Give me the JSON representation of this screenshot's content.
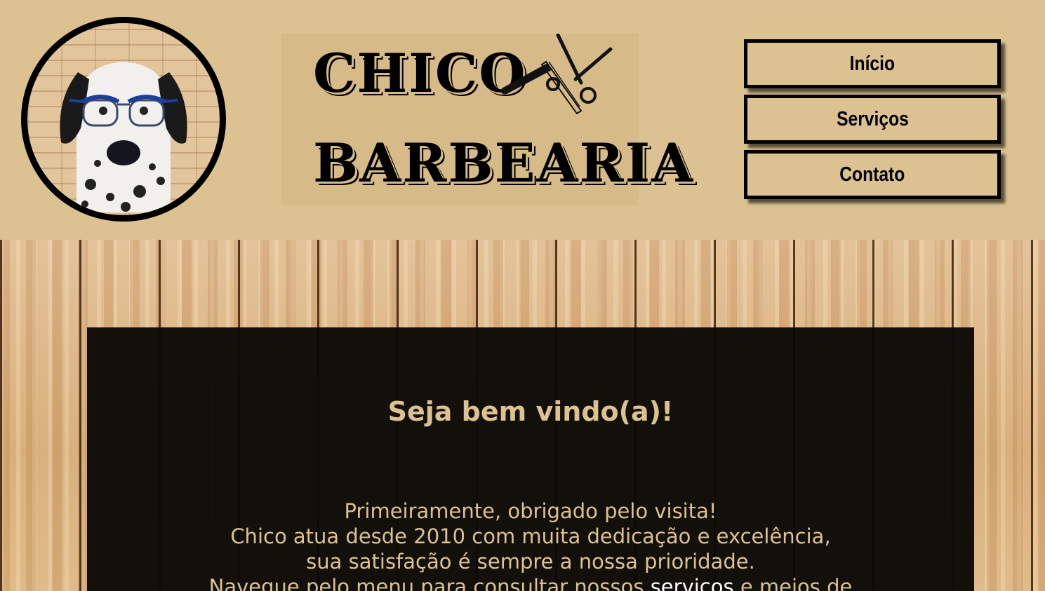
{
  "header": {
    "logo_line1": "CHICO",
    "logo_line2": "BARBEARIA"
  },
  "nav": {
    "items": [
      {
        "label": "Início"
      },
      {
        "label": "Serviços"
      },
      {
        "label": "Contato"
      }
    ]
  },
  "main": {
    "welcome": "Seja bem vindo(a)!",
    "intro_line1": "Primeiramente, obrigado pelo visita!",
    "intro_line2": "Chico atua desde 2010 com muita dedicação e excelência,",
    "intro_line3": "sua satisfação é sempre a nossa prioridade.",
    "intro_line4_start": "Navegue pelo menu para consultar nossos",
    "intro_link_servicos": "serviços",
    "intro_line4_end": "e meios de"
  },
  "colors": {
    "header_bg": "#dcc291",
    "panel_bg": "#0a0806",
    "panel_text": "#dcc291",
    "link": "#ffffff"
  }
}
